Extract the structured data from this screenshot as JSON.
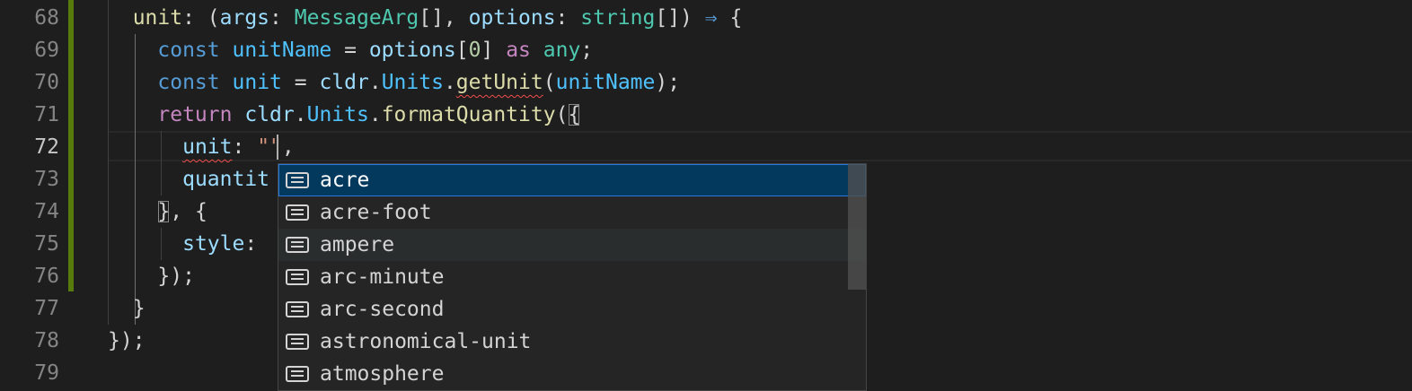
{
  "line_numbers": [
    "68",
    "69",
    "70",
    "71",
    "72",
    "73",
    "74",
    "75",
    "76",
    "77",
    "78",
    "79"
  ],
  "active_line": "72",
  "code": {
    "l68": {
      "indent": "  ",
      "p1": "unit",
      "p2": ": (",
      "p3": "args",
      "p4": ": ",
      "p5": "MessageArg",
      "p6": "[], ",
      "p7": "options",
      "p8": ": ",
      "p9": "string",
      "p10": "[]) ",
      "p11": "⇒",
      "p12": " {"
    },
    "l69": {
      "indent": "    ",
      "p1": "const",
      "p2": " ",
      "p3": "unitName",
      "p4": " = ",
      "p5": "options",
      "p6": "[",
      "p7": "0",
      "p8": "] ",
      "p9": "as",
      "p10": " ",
      "p11": "any",
      "p12": ";"
    },
    "l70": {
      "indent": "    ",
      "p1": "const",
      "p2": " ",
      "p3": "unit",
      "p4": " = ",
      "p5": "cldr",
      "p6": ".",
      "p7": "Units",
      "p8": ".",
      "p9": "getUnit",
      "p10": "(",
      "p11": "unitName",
      "p12": ");"
    },
    "l71": {
      "indent": "    ",
      "p1": "return",
      "p2": " ",
      "p3": "cldr",
      "p4": ".",
      "p5": "Units",
      "p6": ".",
      "p7": "formatQuantity",
      "p8": "(",
      "p9": "{"
    },
    "l72": {
      "indent": "      ",
      "p1": "unit",
      "p2": ": ",
      "p3": "\"",
      "p4": "\"",
      "p5": ","
    },
    "l73": {
      "indent": "      ",
      "p1": "quantit"
    },
    "l74": {
      "indent": "    ",
      "p1": "}",
      "p2": ", {"
    },
    "l75": {
      "indent": "      ",
      "p1": "style",
      "p2": ": "
    },
    "l76": {
      "indent": "    ",
      "p1": "});"
    },
    "l77": {
      "indent": "  ",
      "p1": "}"
    },
    "l78": {
      "indent": "",
      "p1": "});"
    },
    "l79": {
      "indent": "",
      "p1": ""
    }
  },
  "suggestions": [
    {
      "label": "acre",
      "icon": "unit-text-icon"
    },
    {
      "label": "acre-foot",
      "icon": "unit-text-icon"
    },
    {
      "label": "ampere",
      "icon": "unit-text-icon"
    },
    {
      "label": "arc-minute",
      "icon": "unit-text-icon"
    },
    {
      "label": "arc-second",
      "icon": "unit-text-icon"
    },
    {
      "label": "astronomical-unit",
      "icon": "unit-text-icon"
    },
    {
      "label": "atmosphere",
      "icon": "unit-text-icon"
    }
  ],
  "colors": {
    "background": "#1e1e1e",
    "suggest_selected": "#04395e",
    "git_modified": "#587c0c",
    "error_squiggle": "#f14c4c"
  }
}
